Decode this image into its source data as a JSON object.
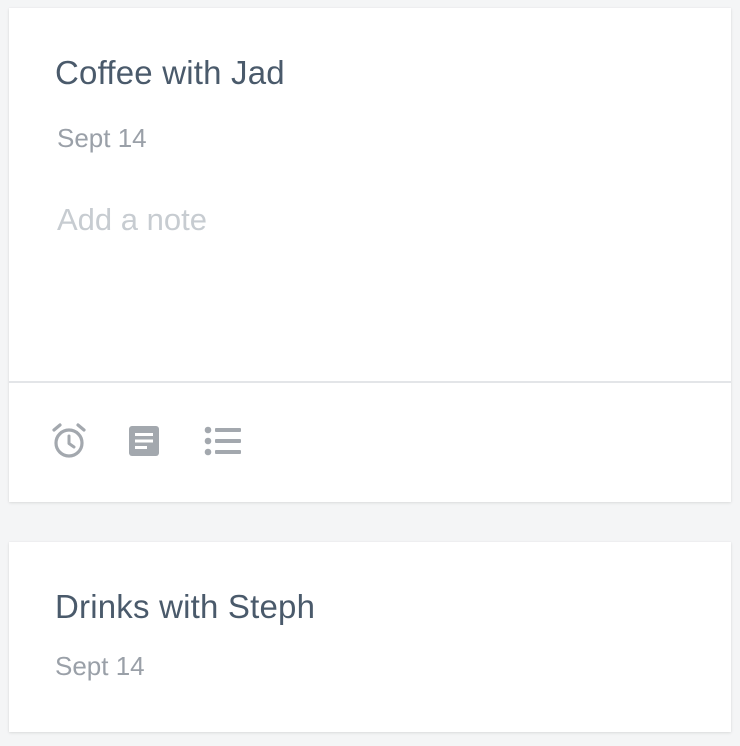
{
  "cards": [
    {
      "title": "Coffee with Jad",
      "date": "Sept 14",
      "note_placeholder": "Add a note",
      "note_value": "",
      "toolbar": [
        "alarm-icon",
        "note-icon",
        "list-icon"
      ]
    },
    {
      "title": "Drinks with Steph",
      "date": "Sept 14"
    }
  ],
  "colors": {
    "title": "#4a5a6b",
    "date": "#9aa0a8",
    "placeholder": "#c7ccd1",
    "icon": "#a3a8ae",
    "divider": "#e3e5e8"
  }
}
